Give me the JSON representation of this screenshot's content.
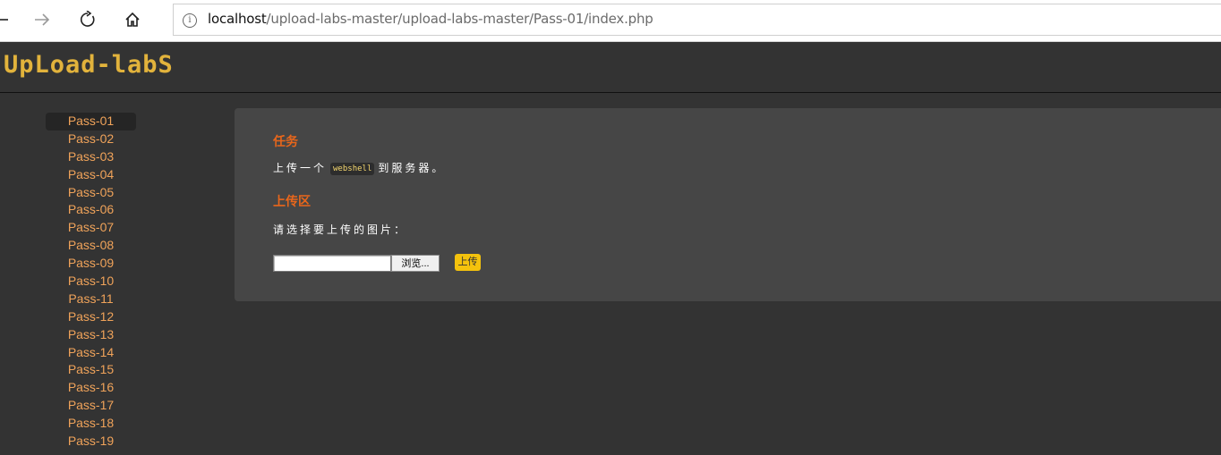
{
  "browser": {
    "url_host": "localhost",
    "url_path": "/upload-labs-master/upload-labs-master/Pass-01/index.php",
    "info_icon": "i"
  },
  "site": {
    "logo_text": "UpLoad-labS"
  },
  "sidebar": {
    "items": [
      "Pass-01",
      "Pass-02",
      "Pass-03",
      "Pass-04",
      "Pass-05",
      "Pass-06",
      "Pass-07",
      "Pass-08",
      "Pass-09",
      "Pass-10",
      "Pass-11",
      "Pass-12",
      "Pass-13",
      "Pass-14",
      "Pass-15",
      "Pass-16",
      "Pass-17",
      "Pass-18",
      "Pass-19"
    ],
    "active": "Pass-01"
  },
  "main": {
    "task_heading": "任务",
    "task_prefix": "上传一个",
    "task_code": "webshell",
    "task_suffix": "到服务器。",
    "upload_heading": "上传区",
    "select_prompt": "请选择要上传的图片：",
    "browse_label": "浏览...",
    "upload_label": "上传"
  },
  "colors": {
    "accent": "#e8661b",
    "menu_link": "#f0a35a",
    "button": "#f4c20d"
  }
}
